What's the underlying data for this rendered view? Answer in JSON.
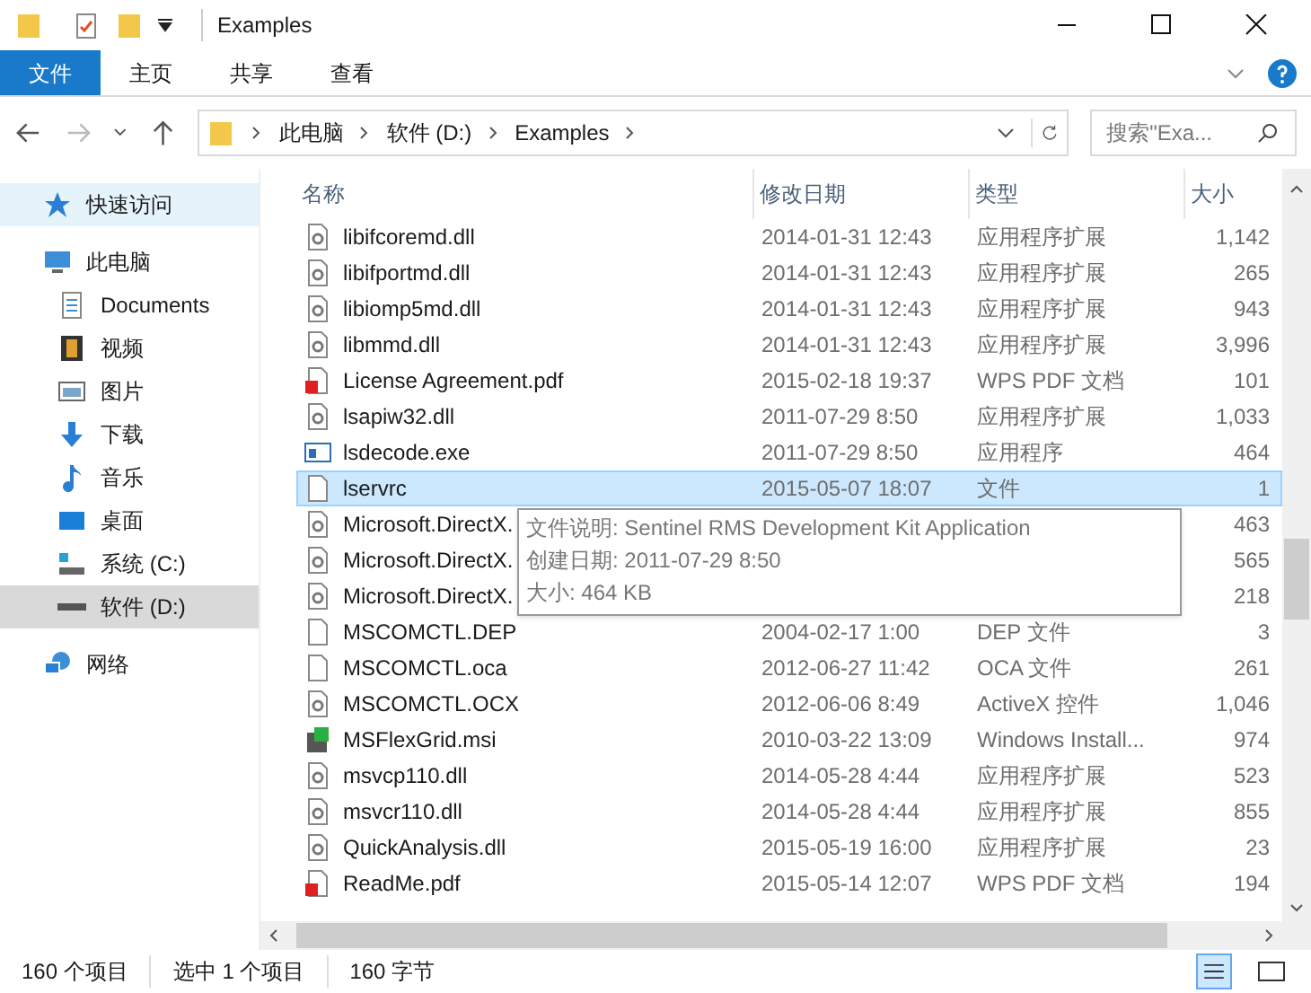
{
  "window": {
    "title": "Examples"
  },
  "ribbon_tabs": [
    {
      "label": "文件",
      "selected": true
    },
    {
      "label": "主页",
      "selected": false
    },
    {
      "label": "共享",
      "selected": false
    },
    {
      "label": "查看",
      "selected": false
    }
  ],
  "address": {
    "crumbs": [
      "此电脑",
      "软件 (D:)",
      "Examples"
    ]
  },
  "search": {
    "placeholder": "搜索\"Exa..."
  },
  "nav": [
    {
      "label": "快速访问",
      "kind": "star",
      "hovered": true,
      "selected": false
    },
    {
      "label": "此电脑",
      "kind": "pc",
      "hovered": false,
      "selected": false,
      "children": [
        {
          "label": "Documents",
          "kind": "doc",
          "hovered": false,
          "selected": false
        },
        {
          "label": "视频",
          "kind": "video",
          "hovered": false,
          "selected": false
        },
        {
          "label": "图片",
          "kind": "picture",
          "hovered": false,
          "selected": false
        },
        {
          "label": "下载",
          "kind": "download",
          "hovered": false,
          "selected": false
        },
        {
          "label": "音乐",
          "kind": "music",
          "hovered": false,
          "selected": false
        },
        {
          "label": "桌面",
          "kind": "desktop",
          "hovered": false,
          "selected": false
        },
        {
          "label": "系统 (C:)",
          "kind": "sysdrive",
          "hovered": false,
          "selected": false
        },
        {
          "label": "软件 (D:)",
          "kind": "drive",
          "hovered": false,
          "selected": true
        }
      ]
    },
    {
      "label": "网络",
      "kind": "network",
      "hovered": false,
      "selected": false
    }
  ],
  "columns": [
    "名称",
    "修改日期",
    "类型",
    "大小"
  ],
  "rows": [
    {
      "kind": "dll",
      "name": "libifcoremd.dll",
      "date": "2014-01-31 12:43",
      "type": "应用程序扩展",
      "size": "1,142",
      "selected": false
    },
    {
      "kind": "dll",
      "name": "libifportmd.dll",
      "date": "2014-01-31 12:43",
      "type": "应用程序扩展",
      "size": "265",
      "selected": false
    },
    {
      "kind": "dll",
      "name": "libiomp5md.dll",
      "date": "2014-01-31 12:43",
      "type": "应用程序扩展",
      "size": "943",
      "selected": false
    },
    {
      "kind": "dll",
      "name": "libmmd.dll",
      "date": "2014-01-31 12:43",
      "type": "应用程序扩展",
      "size": "3,996",
      "selected": false
    },
    {
      "kind": "pdf",
      "name": "License Agreement.pdf",
      "date": "2015-02-18 19:37",
      "type": "WPS PDF 文档",
      "size": "101",
      "selected": false
    },
    {
      "kind": "dll",
      "name": "lsapiw32.dll",
      "date": "2011-07-29 8:50",
      "type": "应用程序扩展",
      "size": "1,033",
      "selected": false
    },
    {
      "kind": "exe",
      "name": "lsdecode.exe",
      "date": "2011-07-29 8:50",
      "type": "应用程序",
      "size": "464",
      "selected": false
    },
    {
      "kind": "file",
      "name": "lservrc",
      "date": "2015-05-07 18:07",
      "type": "文件",
      "size": "1",
      "selected": true
    },
    {
      "kind": "dll",
      "name": "Microsoft.DirectX.",
      "size": "463",
      "selected": false
    },
    {
      "kind": "dll",
      "name": "Microsoft.DirectX.",
      "size": "565",
      "selected": false
    },
    {
      "kind": "dll",
      "name": "Microsoft.DirectX.",
      "size": "218",
      "selected": false
    },
    {
      "kind": "file",
      "name": "MSCOMCTL.DEP",
      "date": "2004-02-17 1:00",
      "type": "DEP 文件",
      "size": "3",
      "selected": false
    },
    {
      "kind": "file",
      "name": "MSCOMCTL.oca",
      "date": "2012-06-27 11:42",
      "type": "OCA 文件",
      "size": "261",
      "selected": false
    },
    {
      "kind": "dll",
      "name": "MSCOMCTL.OCX",
      "date": "2012-06-06 8:49",
      "type": "ActiveX 控件",
      "size": "1,046",
      "selected": false
    },
    {
      "kind": "msi",
      "name": "MSFlexGrid.msi",
      "date": "2010-03-22 13:09",
      "type": "Windows Install...",
      "size": "974",
      "selected": false
    },
    {
      "kind": "dll",
      "name": "msvcp110.dll",
      "date": "2014-05-28 4:44",
      "type": "应用程序扩展",
      "size": "523",
      "selected": false
    },
    {
      "kind": "dll",
      "name": "msvcr110.dll",
      "date": "2014-05-28 4:44",
      "type": "应用程序扩展",
      "size": "855",
      "selected": false
    },
    {
      "kind": "dll",
      "name": "QuickAnalysis.dll",
      "date": "2015-05-19 16:00",
      "type": "应用程序扩展",
      "size": "23",
      "selected": false
    },
    {
      "kind": "pdf",
      "name": "ReadMe.pdf",
      "date": "2015-05-14 12:07",
      "type": "WPS PDF 文档",
      "size": "194",
      "selected": false
    }
  ],
  "tooltip": [
    "文件说明: Sentinel RMS Development Kit Application",
    "创建日期: 2011-07-29 8:50",
    "大小: 464 KB"
  ],
  "status_bar": [
    "160 个项目",
    "选中 1 个项目",
    "160 字节"
  ]
}
